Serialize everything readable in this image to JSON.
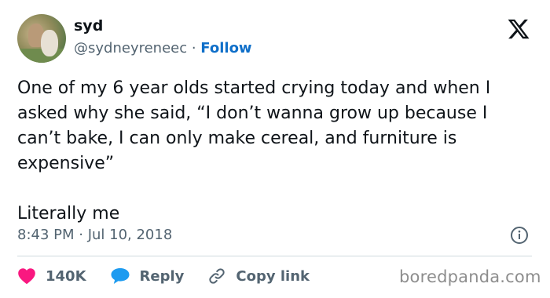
{
  "author": {
    "name": "syd",
    "handle": "@sydneyreneec",
    "separator": " · ",
    "follow_label": "Follow"
  },
  "tweet": {
    "paragraphs": [
      "One of my 6 year olds started crying today and when I asked why she said, “I don’t wanna grow up because I can’t bake, I can only make cereal, and furniture is expensive”",
      "Literally me"
    ],
    "timestamp": "8:43 PM · Jul 10, 2018"
  },
  "actions": {
    "likes_count": "140K",
    "reply_label": "Reply",
    "copy_link_label": "Copy link"
  },
  "icons": {
    "logo": "x-logo-icon",
    "info": "info-icon",
    "like": "heart-icon",
    "reply": "speech-bubble-icon",
    "copy": "link-icon"
  },
  "colors": {
    "like": "#f91880",
    "reply": "#1d9bf0",
    "follow": "#0f6fc9",
    "muted": "#536471"
  },
  "watermark": "boredpanda.com"
}
